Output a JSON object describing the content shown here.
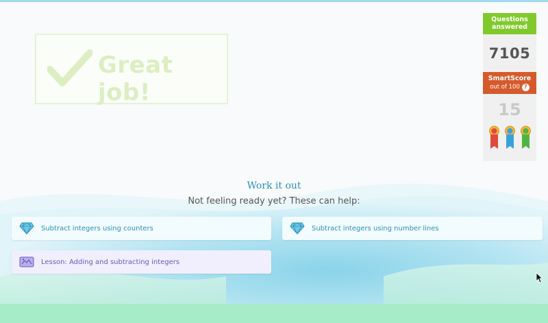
{
  "banner": {
    "text": "Great job!"
  },
  "stats": {
    "questions_answered_label": "Questions answered",
    "questions_answered_value": "7105",
    "smartscore_label": "SmartScore",
    "smartscore_sub": "out of 100",
    "smartscore_value": "15",
    "medal_colors": [
      "#e04a3a",
      "#3aa0dc",
      "#4fb542"
    ]
  },
  "work": {
    "title": "Work it out",
    "subtitle": "Not feeling ready yet? These can help:",
    "links": [
      {
        "label": "Subtract integers using counters",
        "icon": "diamond-icon"
      },
      {
        "label": "Subtract integers using number lines",
        "icon": "diamond-icon"
      },
      {
        "label": "Lesson: Adding and subtracting integers",
        "icon": "lesson-icon"
      }
    ]
  },
  "colors": {
    "accent_blue": "#2a90b8",
    "green": "#80c92c",
    "orange": "#d55a2b",
    "lesson_purple": "#6b58b8"
  }
}
